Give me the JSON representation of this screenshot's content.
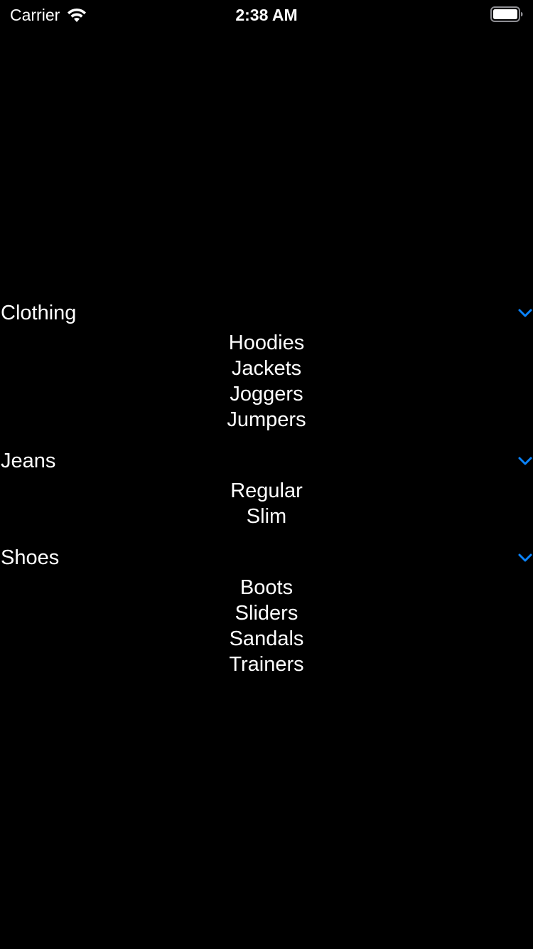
{
  "status_bar": {
    "carrier": "Carrier",
    "time": "2:38 AM",
    "wifi_icon": "wifi-icon",
    "battery_icon": "battery-full-icon"
  },
  "accent_color": "#0a84ff",
  "sections": [
    {
      "title": "Clothing",
      "chevron_icon": "chevron-down-icon",
      "items": [
        "Hoodies",
        "Jackets",
        "Joggers",
        "Jumpers"
      ]
    },
    {
      "title": "Jeans",
      "chevron_icon": "chevron-down-icon",
      "items": [
        "Regular",
        "Slim"
      ]
    },
    {
      "title": "Shoes",
      "chevron_icon": "chevron-down-icon",
      "items": [
        "Boots",
        "Sliders",
        "Sandals",
        "Trainers"
      ]
    }
  ]
}
